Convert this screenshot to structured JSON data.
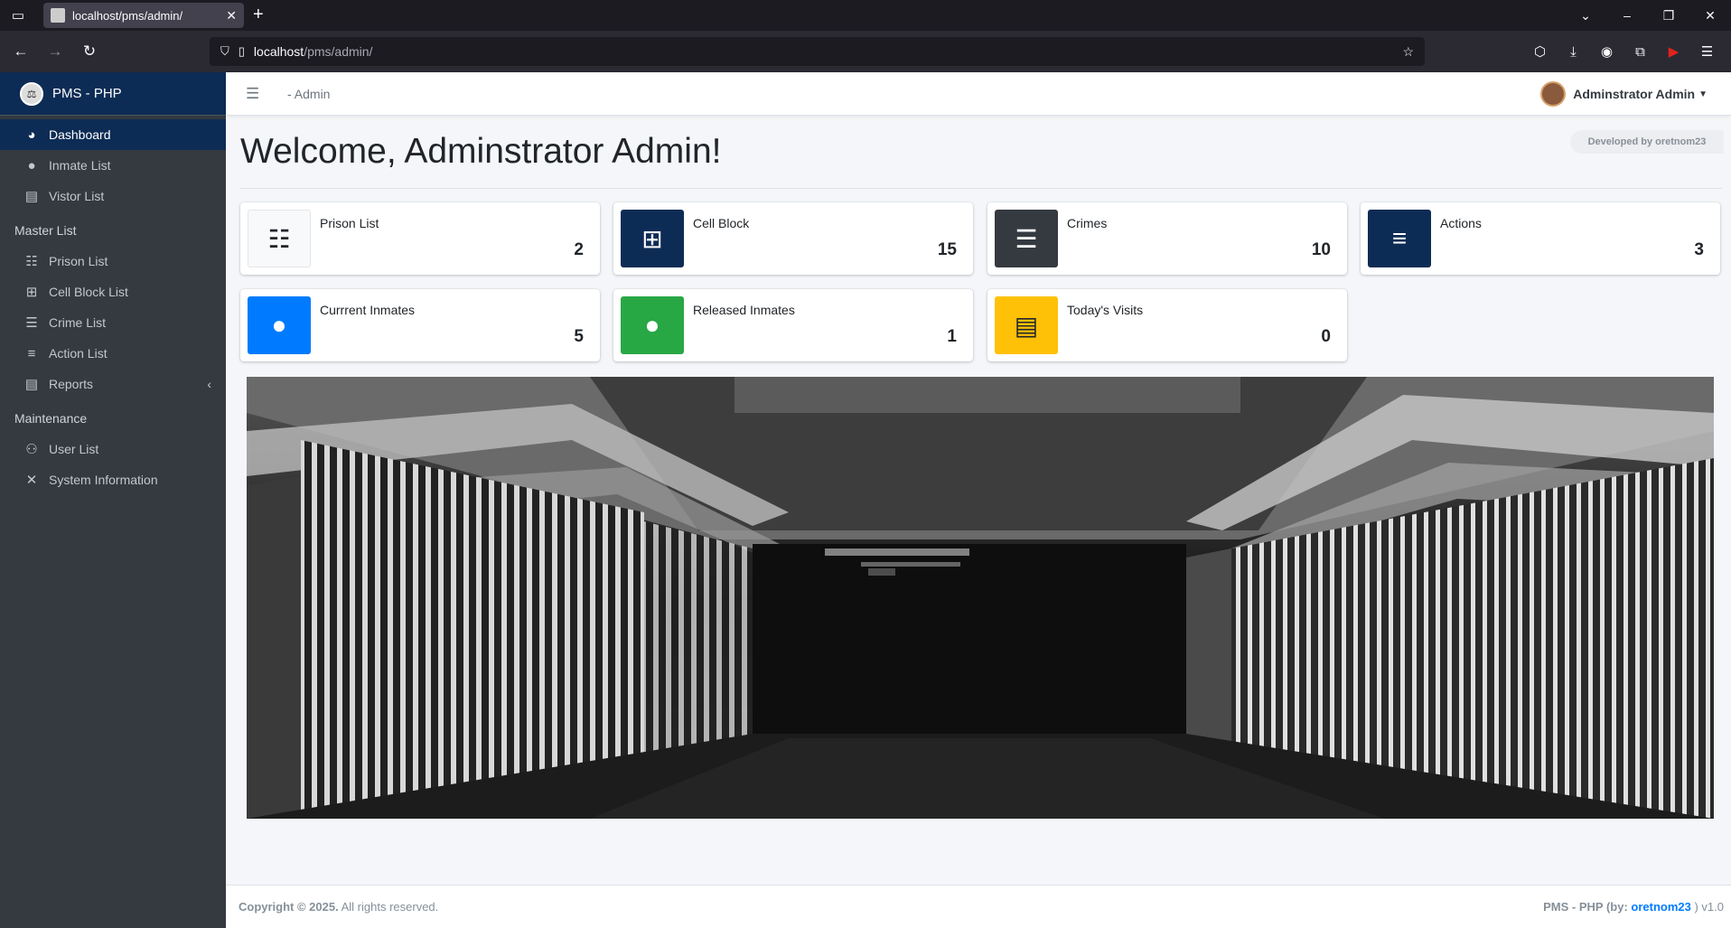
{
  "browser": {
    "tab_title": "localhost/pms/admin/",
    "url_host": "localhost",
    "url_path": "/pms/admin/"
  },
  "sidebar": {
    "brand": "PMS - PHP",
    "items": [
      {
        "label": "Dashboard",
        "icon": "tachometer-icon"
      },
      {
        "label": "Inmate List",
        "icon": "user-icon"
      },
      {
        "label": "Vistor List",
        "icon": "file-icon"
      }
    ],
    "master_header": "Master List",
    "master_items": [
      {
        "label": "Prison List",
        "icon": "table-icon"
      },
      {
        "label": "Cell Block List",
        "icon": "grid-icon"
      },
      {
        "label": "Crime List",
        "icon": "list-icon"
      },
      {
        "label": "Action List",
        "icon": "bars-icon"
      },
      {
        "label": "Reports",
        "icon": "file-icon"
      }
    ],
    "maintenance_header": "Maintenance",
    "maintenance_items": [
      {
        "label": "User List",
        "icon": "users-icon"
      },
      {
        "label": "System Information",
        "icon": "tools-icon"
      }
    ]
  },
  "topnav": {
    "breadcrumb": "- Admin",
    "user_name": "Adminstrator Admin"
  },
  "main": {
    "welcome": "Welcome, Adminstrator Admin!",
    "developed_by": "Developed by oretnom23",
    "boxes": [
      {
        "label": "Prison List",
        "value": "2",
        "color": "#f8f9fa"
      },
      {
        "label": "Cell Block",
        "value": "15",
        "color": "#0d2c55"
      },
      {
        "label": "Crimes",
        "value": "10",
        "color": "#343a40"
      },
      {
        "label": "Actions",
        "value": "3",
        "color": "#0d2c55"
      },
      {
        "label": "Currrent Inmates",
        "value": "5",
        "color": "#007bff"
      },
      {
        "label": "Released Inmates",
        "value": "1",
        "color": "#28a745"
      },
      {
        "label": "Today's Visits",
        "value": "0",
        "color": "#ffc107"
      }
    ]
  },
  "footer": {
    "copyright_bold": "Copyright © 2025.",
    "copyright_rest": " All rights reserved.",
    "right_prefix": "PMS - PHP (by: ",
    "right_link": "oretnom23",
    "right_suffix": " ) v1.0"
  }
}
